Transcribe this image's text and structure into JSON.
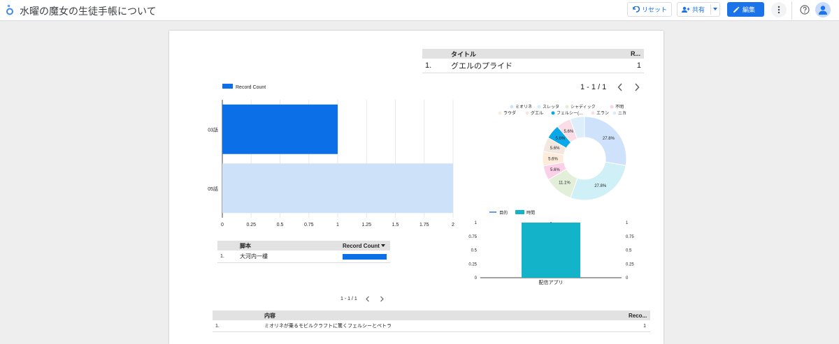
{
  "app": {
    "title": "水曜の魔女の生徒手帳について",
    "reset_label": "リセット",
    "share_label": "共有",
    "edit_label": "編集",
    "brand_color": "#1a73e8"
  },
  "table_title": {
    "headers": [
      "タイトル",
      "R..."
    ],
    "rows": [
      {
        "index": "1.",
        "title": "グエルのプライド",
        "count": "1"
      }
    ]
  },
  "pager_top": {
    "text": "1 - 1 / 1"
  },
  "bar_chart": {
    "legend": "Record Count",
    "color_dark": "#0b6fe8",
    "color_light": "#cde1f8"
  },
  "chart_data": [
    {
      "type": "bar",
      "orientation": "horizontal",
      "categories": [
        "03話",
        "05話"
      ],
      "series": [
        {
          "name": "Record Count",
          "values": [
            1,
            2
          ]
        }
      ],
      "xlim": [
        0,
        2
      ],
      "xticks": [
        "0",
        "0.25",
        "0.5",
        "0.75",
        "1",
        "1.25",
        "1.5",
        "1.75",
        "2"
      ],
      "grid": true,
      "legend": "top-left"
    },
    {
      "type": "pie",
      "donut": true,
      "legend": "top",
      "labels": [
        "ミオリネ",
        "スレッタ",
        "シャディック",
        "不明",
        "ラウダ",
        "グエル",
        "フェルシー(...",
        "エラン",
        "ニカ"
      ],
      "values": [
        27.8,
        27.8,
        11.1,
        5.6,
        5.6,
        5.6,
        5.6,
        5.6,
        5.6
      ],
      "colors": [
        "#cfe2fc",
        "#cff0f6",
        "#e3efd9",
        "#fbd0e8",
        "#fcecd9",
        "#f4e7e0",
        "#0aa8e8",
        "#fbdde8",
        "#dcedfb"
      ],
      "data_labels": [
        "27.8%",
        "27.8%",
        "11.1%",
        "5.6%",
        "5.6%",
        "5.6%",
        "5.6%",
        "5.6%"
      ]
    },
    {
      "type": "bar",
      "categories": [
        "配信アプリ"
      ],
      "series": [
        {
          "name": "目的",
          "type": "line",
          "values": [
            1
          ]
        },
        {
          "name": "時間",
          "values": [
            1
          ]
        }
      ],
      "ylim": [
        0,
        1
      ],
      "yticks": [
        "0",
        "0.25",
        "0.5",
        "0.75",
        "1"
      ],
      "legend": "top"
    }
  ],
  "table_script": {
    "headers": [
      "脚本",
      "Record Count"
    ],
    "rows": [
      {
        "index": "1.",
        "name": "大河内一樓",
        "bar_fraction": 1
      }
    ]
  },
  "pager_mid": {
    "text": "1 - 1 / 1"
  },
  "table_content": {
    "headers": [
      "内容",
      "Reco..."
    ],
    "rows": [
      {
        "index": "1.",
        "content": "ミオリネが乗るモビルクラフトに驚くフェルシーとペトラ",
        "count": "1"
      }
    ]
  }
}
